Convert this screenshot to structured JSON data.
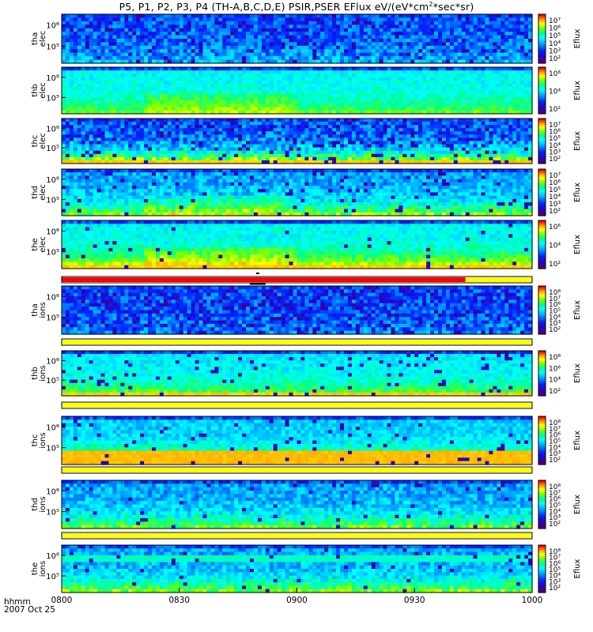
{
  "title": {
    "prefix": "P5, P1, P2, P3, P4 (TH-A,B,C,D,E) PSIR,PSER EFlux eV/(eV*cm",
    "sup": "2",
    "suffix": "*sec*sr)"
  },
  "footer": {
    "hhmm": "hhmm",
    "date": "2007 Oct 25"
  },
  "colors": {
    "status_red": "#ff0000",
    "status_yellow": "#ffff00",
    "axis": "#000000"
  },
  "chart_data": {
    "type": "heatmap",
    "colormap": "rainbow (purple-blue-cyan-green-yellow-red)",
    "x": {
      "ticks": [
        "0800",
        "0830",
        "0900",
        "0930",
        "1000"
      ],
      "range": [
        "0800",
        "1000"
      ],
      "label": "hhmm"
    },
    "panels": [
      {
        "id": "tha_elec",
        "ylabel": [
          "tha",
          "elec"
        ],
        "yticks": [
          "10⁶",
          "10⁵"
        ],
        "cbar": {
          "ticks": [
            "10⁷",
            "10⁶",
            "10⁵",
            "10⁴",
            "10³",
            "10²"
          ],
          "label": "Eflux"
        }
      },
      {
        "id": "thb_elec",
        "ylabel": [
          "thb",
          "elec"
        ],
        "yticks": [
          "10⁶",
          "10⁵"
        ],
        "cbar": {
          "ticks": [
            "10⁶",
            "10⁴",
            "10²"
          ],
          "label": "Eflux"
        }
      },
      {
        "id": "thc_elec",
        "ylabel": [
          "thc",
          "elec"
        ],
        "yticks": [
          "10⁶",
          "10⁵"
        ],
        "cbar": {
          "ticks": [
            "10⁷",
            "10⁶",
            "10⁵",
            "10⁴",
            "10³",
            "10²"
          ],
          "label": "Eflux"
        }
      },
      {
        "id": "thd_elec",
        "ylabel": [
          "thd",
          "elec"
        ],
        "yticks": [
          "10⁶",
          "10⁵"
        ],
        "cbar": {
          "ticks": [
            "10⁷",
            "10⁶",
            "10⁵",
            "10⁴",
            "10³",
            "10²"
          ],
          "label": "Eflux"
        }
      },
      {
        "id": "the_elec",
        "ylabel": [
          "the",
          "elec"
        ],
        "yticks": [
          "10⁶",
          "10⁵"
        ],
        "cbar": {
          "ticks": [
            "10⁶",
            "10⁴",
            "10²"
          ],
          "label": "Eflux"
        }
      },
      {
        "id": "tha_ions",
        "ylabel": [
          "tha",
          "ions"
        ],
        "yticks": [
          "10⁶",
          "10⁵"
        ],
        "cbar": {
          "ticks": [
            "10⁸",
            "10⁷",
            "10⁶",
            "10⁵",
            "10⁴",
            "10³",
            "10²"
          ],
          "label": "Eflux"
        }
      },
      {
        "id": "thb_ions",
        "ylabel": [
          "thb",
          "ions"
        ],
        "yticks": [
          "10⁶",
          "10⁵"
        ],
        "cbar": {
          "ticks": [
            "10⁸",
            "10⁶",
            "10⁴",
            "10²"
          ],
          "label": "Eflux"
        }
      },
      {
        "id": "thc_ions",
        "ylabel": [
          "thc",
          "ions"
        ],
        "yticks": [
          "10⁶",
          "10⁵"
        ],
        "cbar": {
          "ticks": [
            "10⁸",
            "10⁷",
            "10⁶",
            "10⁵",
            "10⁴",
            "10³",
            "10²"
          ],
          "label": "Eflux"
        }
      },
      {
        "id": "thd_ions",
        "ylabel": [
          "thd",
          "ions"
        ],
        "yticks": [
          "10⁶",
          "10⁵"
        ],
        "cbar": {
          "ticks": [
            "10⁸",
            "10⁷",
            "10⁶",
            "10⁵",
            "10⁴",
            "10³",
            "10²"
          ],
          "label": "Eflux"
        }
      },
      {
        "id": "the_ions",
        "ylabel": [
          "the",
          "ions"
        ],
        "yticks": [
          "10⁶",
          "10⁵"
        ],
        "cbar": {
          "ticks": [
            "10⁸",
            "10⁷",
            "10⁶",
            "10⁵",
            "10⁴",
            "10³",
            "10²"
          ],
          "label": "Eflux"
        }
      }
    ],
    "status_bars": [
      {
        "id": "bar1",
        "segments": [
          {
            "color": "red",
            "from": "0800",
            "to": "0943"
          },
          {
            "color": "yellow",
            "from": "0943",
            "to": "1000"
          }
        ],
        "marker": "0850"
      },
      {
        "id": "bar2",
        "segments": [
          {
            "color": "yellow",
            "from": "0800",
            "to": "1000"
          }
        ]
      },
      {
        "id": "bar3",
        "segments": [
          {
            "color": "yellow",
            "from": "0800",
            "to": "1000"
          }
        ]
      },
      {
        "id": "bar4",
        "segments": [
          {
            "color": "yellow",
            "from": "0800",
            "to": "1000"
          }
        ]
      },
      {
        "id": "bar5",
        "segments": [
          {
            "color": "yellow",
            "from": "0800",
            "to": "1000"
          }
        ]
      }
    ]
  }
}
